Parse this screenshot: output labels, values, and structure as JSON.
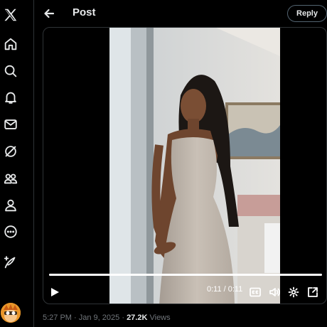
{
  "header": {
    "title": "Post",
    "reply_label": "Reply"
  },
  "nav": {
    "items": [
      {
        "icon": "x-logo-icon"
      },
      {
        "icon": "home-icon"
      },
      {
        "icon": "search-icon"
      },
      {
        "icon": "notifications-icon"
      },
      {
        "icon": "messages-icon"
      },
      {
        "icon": "grok-icon"
      },
      {
        "icon": "communities-icon"
      },
      {
        "icon": "profile-icon"
      },
      {
        "icon": "more-icon"
      },
      {
        "icon": "post-compose-icon"
      }
    ]
  },
  "video": {
    "time": "0:11 / 0:11",
    "progress": 1.0,
    "controls": [
      "play-icon",
      "captions-icon",
      "volume-icon",
      "settings-icon",
      "pop-out-icon"
    ]
  },
  "post_meta": {
    "time": "5:27 PM",
    "separator": "·",
    "date": "Jan 9, 2025",
    "views_count": "27.2K",
    "views_label": "Views"
  },
  "colors": {
    "background": "#000000",
    "text": "#e7e9ea",
    "muted": "#71767b",
    "border": "#2f3336"
  }
}
